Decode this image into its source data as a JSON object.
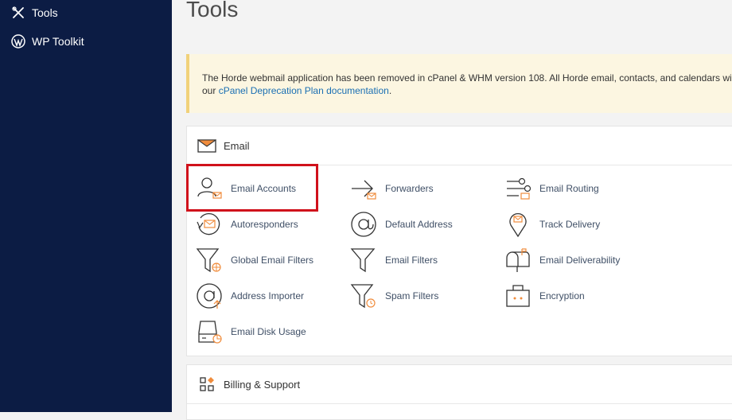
{
  "sidebar": {
    "items": [
      {
        "label": "Tools",
        "icon": "tools-icon"
      },
      {
        "label": "WP Toolkit",
        "icon": "wordpress-icon"
      }
    ]
  },
  "page": {
    "title": "Tools"
  },
  "notice": {
    "text": "The Horde webmail application has been removed in cPanel & WHM version 108. All Horde email, contacts, and calendars will be aut",
    "line2_prefix": "our ",
    "link": "cPanel Deprecation Plan documentation",
    "suffix": "."
  },
  "email_section": {
    "title": "Email",
    "tools": [
      {
        "label": "Email Accounts",
        "icon": "email-accounts-icon"
      },
      {
        "label": "Forwarders",
        "icon": "forwarders-icon"
      },
      {
        "label": "Email Routing",
        "icon": "email-routing-icon"
      },
      {
        "label": "Autoresponders",
        "icon": "autoresponders-icon"
      },
      {
        "label": "Default Address",
        "icon": "default-address-icon"
      },
      {
        "label": "Track Delivery",
        "icon": "track-delivery-icon"
      },
      {
        "label": "Global Email Filters",
        "icon": "global-filter-icon"
      },
      {
        "label": "Email Filters",
        "icon": "filter-icon"
      },
      {
        "label": "Email Deliverability",
        "icon": "mailbox-icon"
      },
      {
        "label": "Address Importer",
        "icon": "address-importer-icon"
      },
      {
        "label": "Spam Filters",
        "icon": "spam-filter-icon"
      },
      {
        "label": "Encryption",
        "icon": "encryption-icon"
      },
      {
        "label": "Email Disk Usage",
        "icon": "disk-usage-icon"
      }
    ]
  },
  "billing_section": {
    "title": "Billing & Support"
  },
  "colors": {
    "sidebar": "#0c1c44",
    "accent": "#f08c3c",
    "highlight": "#d0111b",
    "link": "#1a6fb3"
  }
}
